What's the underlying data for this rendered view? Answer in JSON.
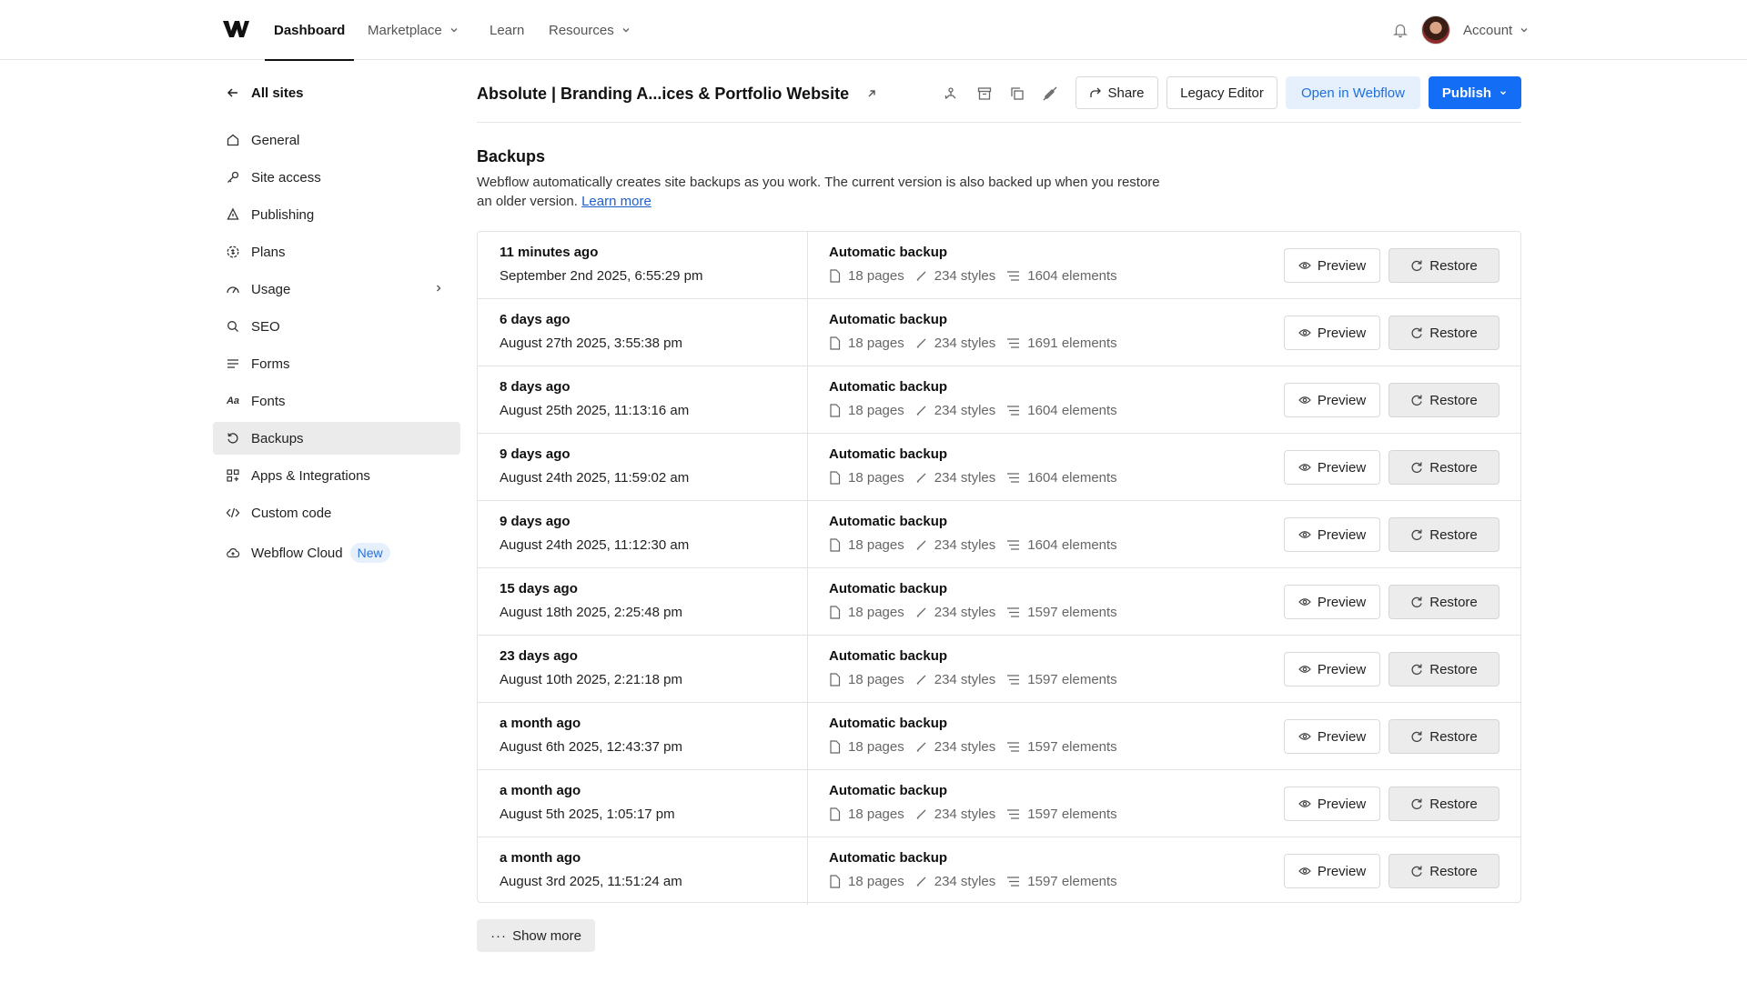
{
  "topnav": {
    "items": [
      {
        "label": "Dashboard"
      },
      {
        "label": "Marketplace"
      },
      {
        "label": "Learn"
      },
      {
        "label": "Resources"
      }
    ],
    "account_label": "Account"
  },
  "sidebar": {
    "back_label": "All sites",
    "items": [
      {
        "label": "General",
        "icon": "home-icon"
      },
      {
        "label": "Site access",
        "icon": "key-icon"
      },
      {
        "label": "Publishing",
        "icon": "publishing-icon"
      },
      {
        "label": "Plans",
        "icon": "plans-icon"
      },
      {
        "label": "Usage",
        "icon": "gauge-icon"
      },
      {
        "label": "SEO",
        "icon": "search-icon"
      },
      {
        "label": "Forms",
        "icon": "forms-icon"
      },
      {
        "label": "Fonts",
        "icon": "fonts-icon"
      },
      {
        "label": "Backups",
        "icon": "backup-icon"
      },
      {
        "label": "Apps & Integrations",
        "icon": "apps-icon"
      },
      {
        "label": "Custom code",
        "icon": "code-icon"
      },
      {
        "label": "Webflow Cloud",
        "icon": "cloud-icon",
        "badge": "New"
      }
    ],
    "fonts_glyph": "Aa"
  },
  "header": {
    "site_title": "Absolute | Branding A...ices & Portfolio Website",
    "share_label": "Share",
    "legacy_label": "Legacy Editor",
    "open_label": "Open in Webflow",
    "publish_label": "Publish"
  },
  "backups": {
    "title": "Backups",
    "description": "Webflow automatically creates site backups as you work. The current version is also backed up when you restore an older version.",
    "learn_more": "Learn more",
    "preview_label": "Preview",
    "restore_label": "Restore",
    "show_more": "Show more",
    "rows": [
      {
        "when": "11 minutes ago",
        "date": "September 2nd 2025, 6:55:29 pm",
        "type": "Automatic backup",
        "pages": "18 pages",
        "styles": "234 styles",
        "elements": "1604 elements"
      },
      {
        "when": "6 days ago",
        "date": "August 27th 2025, 3:55:38 pm",
        "type": "Automatic backup",
        "pages": "18 pages",
        "styles": "234 styles",
        "elements": "1691 elements"
      },
      {
        "when": "8 days ago",
        "date": "August 25th 2025, 11:13:16 am",
        "type": "Automatic backup",
        "pages": "18 pages",
        "styles": "234 styles",
        "elements": "1604 elements"
      },
      {
        "when": "9 days ago",
        "date": "August 24th 2025, 11:59:02 am",
        "type": "Automatic backup",
        "pages": "18 pages",
        "styles": "234 styles",
        "elements": "1604 elements"
      },
      {
        "when": "9 days ago",
        "date": "August 24th 2025, 11:12:30 am",
        "type": "Automatic backup",
        "pages": "18 pages",
        "styles": "234 styles",
        "elements": "1604 elements"
      },
      {
        "when": "15 days ago",
        "date": "August 18th 2025, 2:25:48 pm",
        "type": "Automatic backup",
        "pages": "18 pages",
        "styles": "234 styles",
        "elements": "1597 elements"
      },
      {
        "when": "23 days ago",
        "date": "August 10th 2025, 2:21:18 pm",
        "type": "Automatic backup",
        "pages": "18 pages",
        "styles": "234 styles",
        "elements": "1597 elements"
      },
      {
        "when": "a month ago",
        "date": "August 6th 2025, 12:43:37 pm",
        "type": "Automatic backup",
        "pages": "18 pages",
        "styles": "234 styles",
        "elements": "1597 elements"
      },
      {
        "when": "a month ago",
        "date": "August 5th 2025, 1:05:17 pm",
        "type": "Automatic backup",
        "pages": "18 pages",
        "styles": "234 styles",
        "elements": "1597 elements"
      },
      {
        "when": "a month ago",
        "date": "August 3rd 2025, 11:51:24 am",
        "type": "Automatic backup",
        "pages": "18 pages",
        "styles": "234 styles",
        "elements": "1597 elements"
      }
    ]
  },
  "colors": {
    "accent": "#146ef5",
    "accent_light": "#e6f0fd",
    "active_bg": "#ebebeb"
  }
}
